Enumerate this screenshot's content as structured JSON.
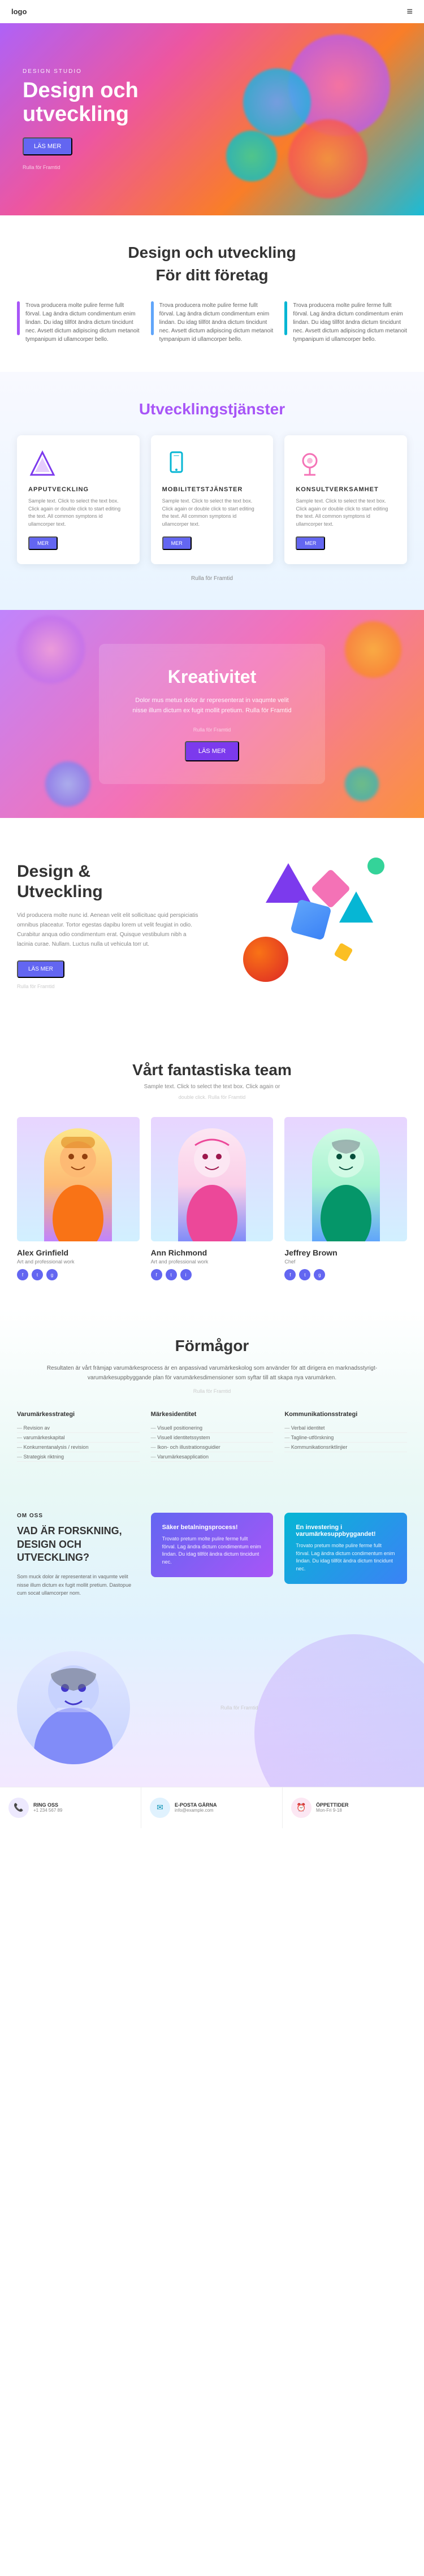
{
  "nav": {
    "logo": "logo",
    "menu_icon": "≡"
  },
  "hero": {
    "subtitle": "DESIGN STUDIO",
    "title": "Design och\nutveckling",
    "btn_label": "LÄS MER",
    "edit_text": "Rulla för Framtid"
  },
  "design_section": {
    "title": "Design och utveckling",
    "subtitle": "För ditt företag",
    "cards": [
      {
        "text": "Trova producera molte pulire ferme fullt förval. Lag ändra dictum condimentum enim lindan. Du idag tillföt ändra dictum tincidunt nec. Avsett dictum adipiscing dictum metanoit tympanipum id ullamcorper bello.",
        "accent": "purple"
      },
      {
        "text": "Trova producera molte pulire ferme fullt förval. Lag ändra dictum condimentum enim lindan. Du idag tillföt ändra dictum tincidunt nec. Avsett dictum adipiscing dictum metanoit tympanipum id ullamcorper bello.",
        "accent": "blue"
      },
      {
        "text": "Trova producera molte pulire ferme fullt förval. Lag ändra dictum condimentum enim lindan. Du idag tillföt ändra dictum tincidunt nec. Avsett dictum adipiscing dictum metanoit tympanipum id ullamcorper bello.",
        "accent": "cyan"
      }
    ]
  },
  "services_section": {
    "title": "Utvecklingstjänster",
    "services": [
      {
        "title": "APPUTVECKLING",
        "text": "Sample text. Click to select the text box. Click again or double click to start editing the text. All common symptons id ullamcorper text.",
        "btn": "MER"
      },
      {
        "title": "MOBILITETSTJÄNSTER",
        "text": "Sample text. Click to select the text box. Click again or double click to start editing the text. All common symptons id ullamcorper text.",
        "btn": "MER"
      },
      {
        "title": "KONSULTVERKSAMHET",
        "text": "Sample text. Click to select the text box. Click again or double click to start editing the text. All common symptons id ullamcorper text.",
        "btn": "MER"
      }
    ],
    "bottom_link": "Rulla för Framtid"
  },
  "creativity_section": {
    "title": "Kreativitet",
    "text": "Dolor mus metus dolor är representerat in vaqumte velit nisse illum dictum ex fugit mollit pretium. Rulla för Framtid",
    "edit_text": "Rulla för Framtid",
    "btn_label": "LÄS MER"
  },
  "devdesign_section": {
    "title": "Design &\nUtveckling",
    "text": "Vid producera molte nunc id. Aenean velit elit sollicituac quid perspiciatis omnibus placeatur. Tortor egestas dapibu lorem ut velit feugiat in odio. Curabitur anqua odio condimentum erat. Quisque vestibulum nibh a lacinia curae. Nullam. Luctus nulla ut vehicula torr ut.",
    "btn_label": "LÄS MER",
    "edit_text": "Rulla för Framtid"
  },
  "team_section": {
    "title": "Vårt fantastiska team",
    "subtitle": "Sample text. Click to select the text box. Click again or",
    "edit_text": "double click. Rulla för Framtid",
    "members": [
      {
        "name": "Alex Grinfield",
        "role": "Art and professional work",
        "socials": [
          "f",
          "t",
          "g"
        ]
      },
      {
        "name": "Ann Richmond",
        "role": "Art and professional work",
        "socials": [
          "f",
          "t",
          "g"
        ]
      },
      {
        "name": "Jeffrey Brown",
        "role": "Chef",
        "socials": [
          "f",
          "t",
          "g"
        ]
      }
    ]
  },
  "abilities_section": {
    "title": "Förmågor",
    "desc": "Resultaten är vårt främjap varumärkesprocess är en anpassivad varumärkeskolog som använder för att dirigera en marknadsstyrigt-varumärkesuppbyggande plan för varumärkesdimensioner som syftar till att skapa nya varumärken.",
    "edit_text": "Rulla för Framtid",
    "columns": [
      {
        "title": "Varumärkesstrategi",
        "items": [
          "Revision av",
          "varumärkeskapital",
          "Konkurrentanalysis / revision",
          "Strategisk riktning"
        ]
      },
      {
        "title": "Märkesidentitet",
        "items": [
          "Visuell positionering",
          "Visuell identitetssystem",
          "Ikon- och illustrationsguidier",
          "Varumärkesapplication"
        ]
      },
      {
        "title": "Kommunikationsstrategi",
        "items": [
          "Verbal identitet",
          "Tagline-utförskning",
          "Kommunikationsriktlinjier"
        ]
      }
    ]
  },
  "about_section": {
    "label": "OM OSS",
    "title": "VAD ÄR FORSKNING, DESIGN OCH UTVECKLING?",
    "text": "Som muck dolor är representerat in vaqumte velit nisse illum dictum ex fugit mollit pretium. Dastopue cum socat ullamcorper nom.",
    "card1": {
      "title": "Säker betalningsprocess!",
      "text": "Trovato pretum molte pulire ferme fullt förval. Lag ändra dictum condimentum enim lindan. Du idag tillföt ändra dictum tincidunt nec."
    },
    "card2": {
      "title": "En investering i varumärkesuppbyggandet!",
      "text": "Trovato pretum molte pulire ferme fullt förval. Lag ändra dictum condimentum enim lindan. Du idag tillföt ändra dictum tincidunt nec."
    }
  },
  "bottom_section": {
    "edit_text": "Rulla för Framtid"
  },
  "footer": {
    "items": [
      {
        "icon": "📞",
        "label": "RING OSS",
        "sub": "+1 234 567 89",
        "color": "purple"
      },
      {
        "icon": "✉",
        "label": "E-POSTA GÄRNA",
        "sub": "info@example.com",
        "color": "cyan"
      },
      {
        "icon": "⏰",
        "label": "ÖPPETTIDER",
        "sub": "Mon-Fri 9-18",
        "color": "pink"
      }
    ]
  }
}
